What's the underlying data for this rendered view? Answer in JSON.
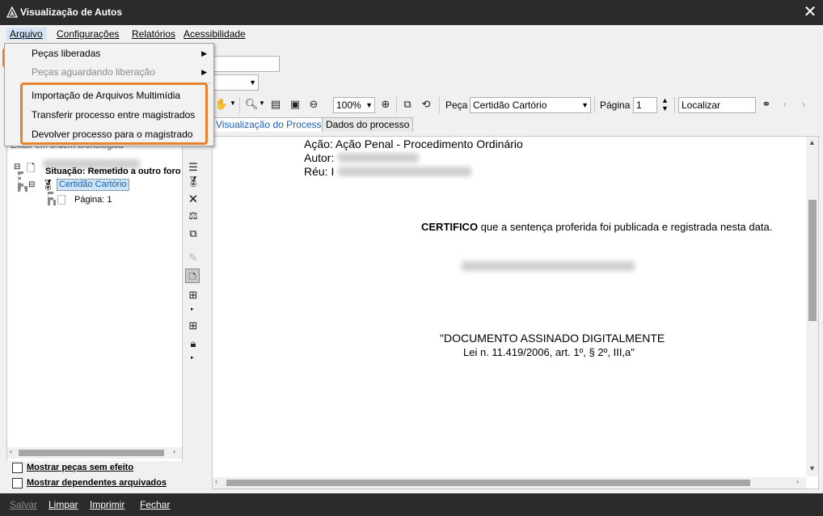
{
  "window": {
    "title": "Visualização de Autos",
    "close_icon": "close-icon"
  },
  "menubar": {
    "items": [
      {
        "label": "Arquivo"
      },
      {
        "label": "Configurações"
      },
      {
        "label": "Relatórios"
      },
      {
        "label": "Acessibilidade"
      }
    ]
  },
  "file_menu": {
    "items": [
      {
        "label": "Peças liberadas",
        "has_submenu": true,
        "enabled": true
      },
      {
        "label": "Peças aguardando liberação",
        "has_submenu": true,
        "enabled": false
      },
      {
        "label": "Importação de Arquivos Multimídia",
        "enabled": true
      },
      {
        "label": "Transferir processo entre magistrados",
        "enabled": true
      },
      {
        "label": "Devolver processo para o magistrado",
        "enabled": true
      }
    ]
  },
  "toolbar": {
    "zoom_value": "100%",
    "peca_label": "Peça",
    "peca_value": "Certidão Cartório",
    "pagina_label": "Página",
    "pagina_value": "1",
    "localizar_value": "Localizar"
  },
  "tabs": [
    {
      "label": "Visualização do Processo",
      "active": true
    },
    {
      "label": "Dados do processo",
      "active": false
    }
  ],
  "left_panel": {
    "header": "Exibir em ordem cronológica",
    "tree": {
      "situacao": "Situação: Remetido a outro foro",
      "certidao": "Certidão Cartório",
      "pagina": "Página: 1"
    },
    "checkbox_sem_efeito": "Mostrar peças sem efeito",
    "checkbox_arquivados": "Mostrar dependentes arquivados"
  },
  "document": {
    "acao": "Ação: Ação Penal - Procedimento Ordinário",
    "autor": "Autor:",
    "reu": "Réu: I",
    "certifico_bold": "CERTIFICO",
    "certifico_rest": " que a sentença proferida foi publicada e registrada nesta data.",
    "assinado_line1": "\"DOCUMENTO ASSINADO DIGITALMENTE",
    "assinado_line2": "Lei n. 11.419/2006, art. 1º, § 2º, III,a\""
  },
  "statusbar": {
    "salvar": "Salvar",
    "limpar": "Limpar",
    "imprimir": "Imprimir",
    "fechar": "Fechar"
  },
  "colors": {
    "highlight": "#e8822a",
    "titlebar": "#2b2b2b",
    "selection": "#cce4f7"
  }
}
